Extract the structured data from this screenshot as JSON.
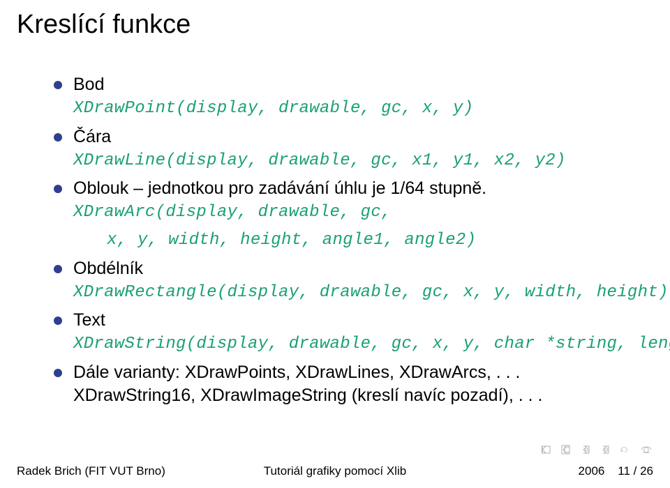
{
  "slide": {
    "title": "Kreslící funkce",
    "bullets": {
      "b0": {
        "label": "Bod"
      },
      "b1": {
        "label": "Čára"
      },
      "b2": {
        "label": "Oblouk",
        "suffix_a": " – jednotkou pro zadávání úhlu je 1/64 stupně."
      },
      "b3": {
        "label": "Obdélník"
      },
      "b4": {
        "label": "Text"
      },
      "b5": {
        "label": "Dále varianty: XDrawPoints, XDrawLines, XDrawArcs, . . . XDrawString16, XDrawImageString (kreslí navíc pozadí), . . ."
      }
    },
    "code": {
      "c0": "XDrawPoint(display, drawable, gc, x, y)",
      "c1": "XDrawLine(display, drawable, gc, x1, y1, x2, y2)",
      "c2a": "XDrawArc(display, drawable, gc,",
      "c2b": "x, y, width, height, angle1, angle2)",
      "c3": "XDrawRectangle(display, drawable, gc, x, y, width, height)",
      "c4": "XDrawString(display, drawable, gc, x, y, char *string, length)"
    }
  },
  "footer": {
    "left": "Radek Brich (FIT VUT Brno)",
    "center": "Tutoriál grafiky pomocí Xlib",
    "right_year": "2006",
    "right_page": "11 / 26"
  }
}
